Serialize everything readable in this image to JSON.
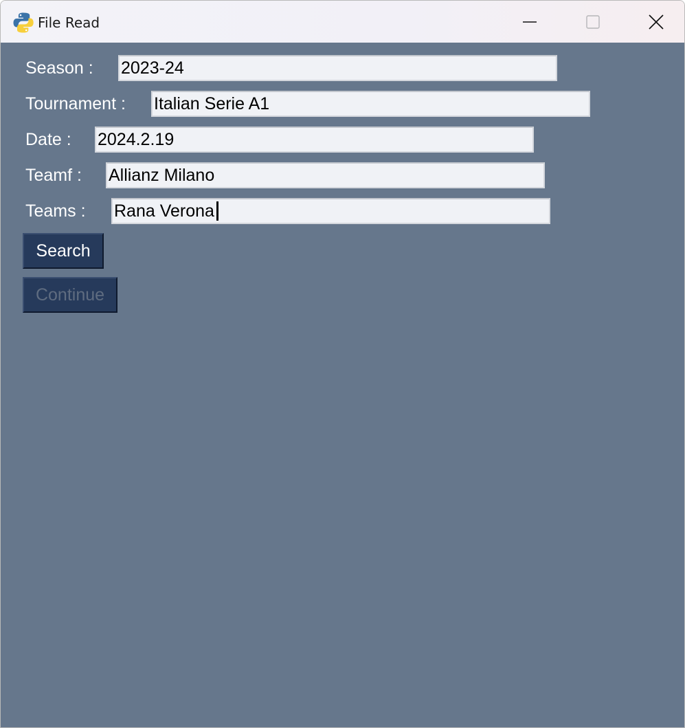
{
  "window": {
    "title": "File Read",
    "icon": "python-icon",
    "controls": [
      "minimize-icon",
      "maximize-icon",
      "close-icon"
    ]
  },
  "form": {
    "season": {
      "label": "Season :",
      "value": "2023-24"
    },
    "tournament": {
      "label": "Tournament :",
      "value": "Italian Serie A1"
    },
    "date": {
      "label": "Date :",
      "value": "2024.2.19"
    },
    "teamf": {
      "label": "Teamf :",
      "value": "Allianz Milano"
    },
    "teams": {
      "label": "Teams :",
      "value": "Rana Verona"
    }
  },
  "buttons": {
    "search": {
      "label": "Search",
      "enabled": true
    },
    "continue": {
      "label": "Continue",
      "enabled": false
    }
  },
  "colors": {
    "background": "#66778c",
    "button": "#263a5b",
    "field": "#f0f2f6"
  }
}
